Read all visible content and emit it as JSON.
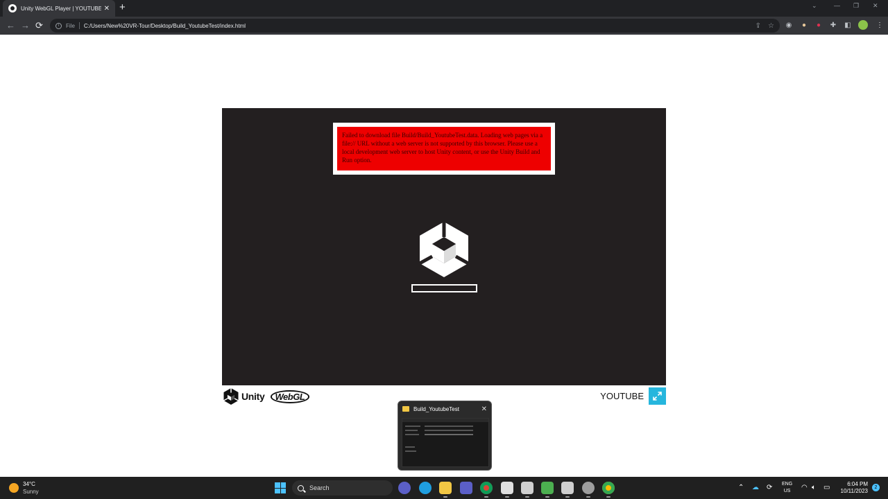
{
  "browser": {
    "tab_title": "Unity WebGL Player | YOUTUBE",
    "tab_close": "✕",
    "new_tab": "+",
    "back": "←",
    "forward": "→",
    "reload": "⟳",
    "file_label": "File",
    "url": "C:/Users/New%20VR-Tour/Desktop/Build_YoutubeTest/index.html"
  },
  "unity": {
    "warning": "Failed to download file Build/Build_YoutubeTest.data. Loading web pages via a file:// URL without a web server is not supported by this browser. Please use a local development web server to host Unity content, or use the Unity Build and Run option.",
    "progress_fraction": 0.0,
    "footer_unity": "Unity",
    "footer_webgl": "WebGL",
    "build_title": "YOUTUBE",
    "colors": {
      "canvas": "#231f20",
      "warning_bg": "#ff0000",
      "fullscreen": "#26b6dd"
    }
  },
  "preview": {
    "title": "Build_YoutubeTest",
    "close": "✕"
  },
  "taskbar": {
    "temperature": "34°C",
    "condition": "Sunny",
    "search_label": "Search",
    "lang_top": "ENG",
    "lang_bottom": "US",
    "time": "6:04 PM",
    "date": "10/11/2023",
    "notifications": "2"
  }
}
